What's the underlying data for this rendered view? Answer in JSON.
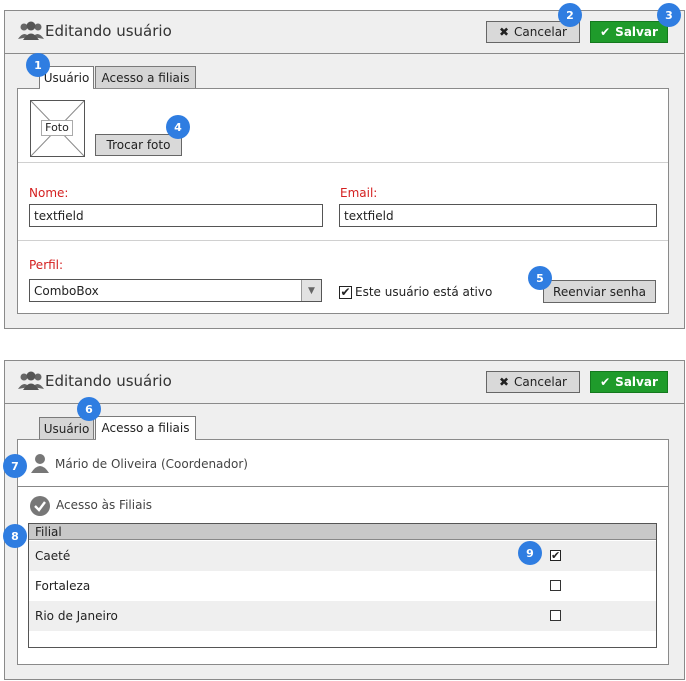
{
  "screen1": {
    "title": "Editando usuário",
    "cancel_label": "Cancelar",
    "save_label": "Salvar",
    "tabs": [
      "Usuário",
      "Acesso a filiais"
    ],
    "photo_label": "Foto",
    "change_photo_label": "Trocar foto",
    "name_label": "Nome:",
    "name_value": "textfield",
    "email_label": "Email:",
    "email_value": "textfield",
    "profile_label": "Perfil:",
    "profile_value": "ComboBox",
    "active_label": "Este usuário está ativo",
    "active_checked": true,
    "resend_label": "Reenviar senha"
  },
  "screen2": {
    "title": "Editando usuário",
    "cancel_label": "Cancelar",
    "save_label": "Salvar",
    "tabs": [
      "Usuário",
      "Acesso a filiais"
    ],
    "user_name": "Mário de Oliveira (Coordenador)",
    "access_title": "Acesso às Filiais",
    "table_header": "Filial",
    "rows": [
      {
        "name": "Caeté",
        "checked": true
      },
      {
        "name": "Fortaleza",
        "checked": false
      },
      {
        "name": "Rio de Janeiro",
        "checked": false
      }
    ]
  },
  "badges": [
    "1",
    "2",
    "3",
    "4",
    "5",
    "6",
    "7",
    "8",
    "9"
  ],
  "colors": {
    "accent_badge": "#2f7de1",
    "save_green": "#1f9b2b",
    "label_red": "#d42020"
  },
  "icons": {
    "users": "users-icon",
    "cancel": "x-icon",
    "save": "check-icon",
    "user": "user-icon",
    "check_circle": "check-circle-icon"
  }
}
